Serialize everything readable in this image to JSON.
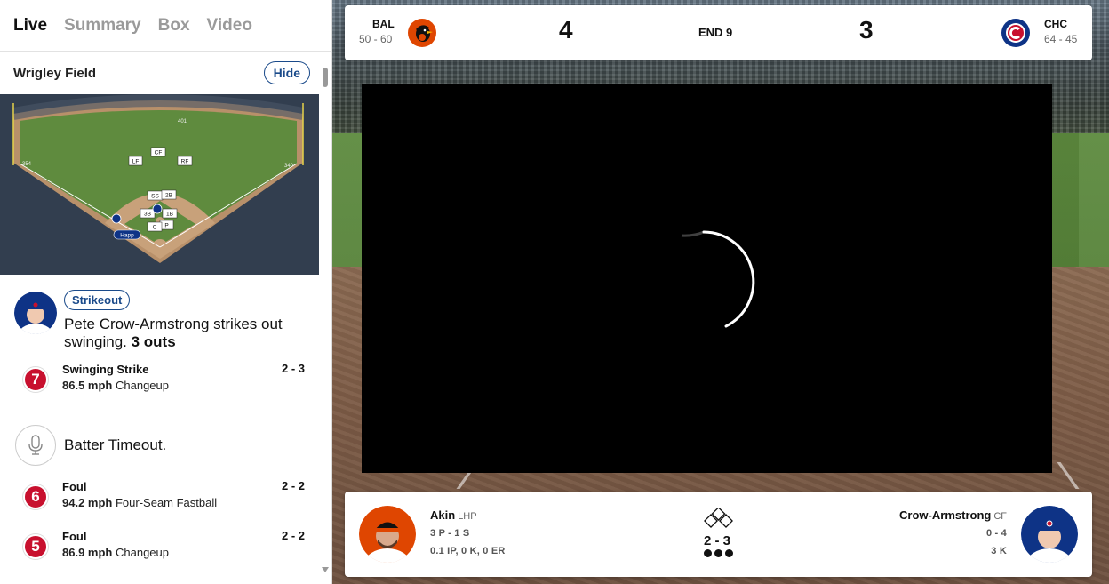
{
  "tabs": [
    "Live",
    "Summary",
    "Box",
    "Video"
  ],
  "venue": {
    "name": "Wrigley Field",
    "hide_label": "Hide"
  },
  "field": {
    "distances": {
      "center": "401",
      "left": "354",
      "right": "340"
    },
    "positions": {
      "lf": "LF",
      "cf": "CF",
      "rf": "RF",
      "ss": "SS",
      "second": "2B",
      "third": "3B",
      "first": "1B",
      "pitcher": "P",
      "catcher": "C"
    },
    "runner_label": "Happ"
  },
  "event": {
    "badge": "Strikeout",
    "description": "Pete Crow-Armstrong strikes out swinging.",
    "outs_text": "3 outs"
  },
  "pitches": [
    {
      "num": "7",
      "title": "Swinging Strike",
      "speed": "86.5 mph",
      "type": "Changeup",
      "count": "2 - 3"
    },
    {
      "num": "6",
      "title": "Foul",
      "speed": "94.2 mph",
      "type": "Four-Seam Fastball",
      "count": "2 - 2"
    },
    {
      "num": "5",
      "title": "Foul",
      "speed": "86.9 mph",
      "type": "Changeup",
      "count": "2 - 2"
    }
  ],
  "timeout_text": "Batter Timeout.",
  "scoreboard": {
    "away": {
      "abbr": "BAL",
      "record": "50 - 60",
      "score": "4",
      "color": "#df4601"
    },
    "home": {
      "abbr": "CHC",
      "record": "64 - 45",
      "score": "3",
      "color": "#0e3386"
    },
    "inning": "END 9"
  },
  "matchup": {
    "pitcher": {
      "name": "Akin",
      "pos": "LHP",
      "line1": "3 P - 1 S",
      "line2": "0.1 IP, 0 K, 0 ER"
    },
    "batter": {
      "name": "Crow-Armstrong",
      "pos": "CF",
      "line1": "0 - 4",
      "line2": "3 K"
    },
    "count": "2 - 3",
    "outs": 3
  },
  "icons": [
    "orioles-logo",
    "cubs-logo",
    "microphone-icon",
    "bases-icon",
    "loading-spinner-icon"
  ]
}
